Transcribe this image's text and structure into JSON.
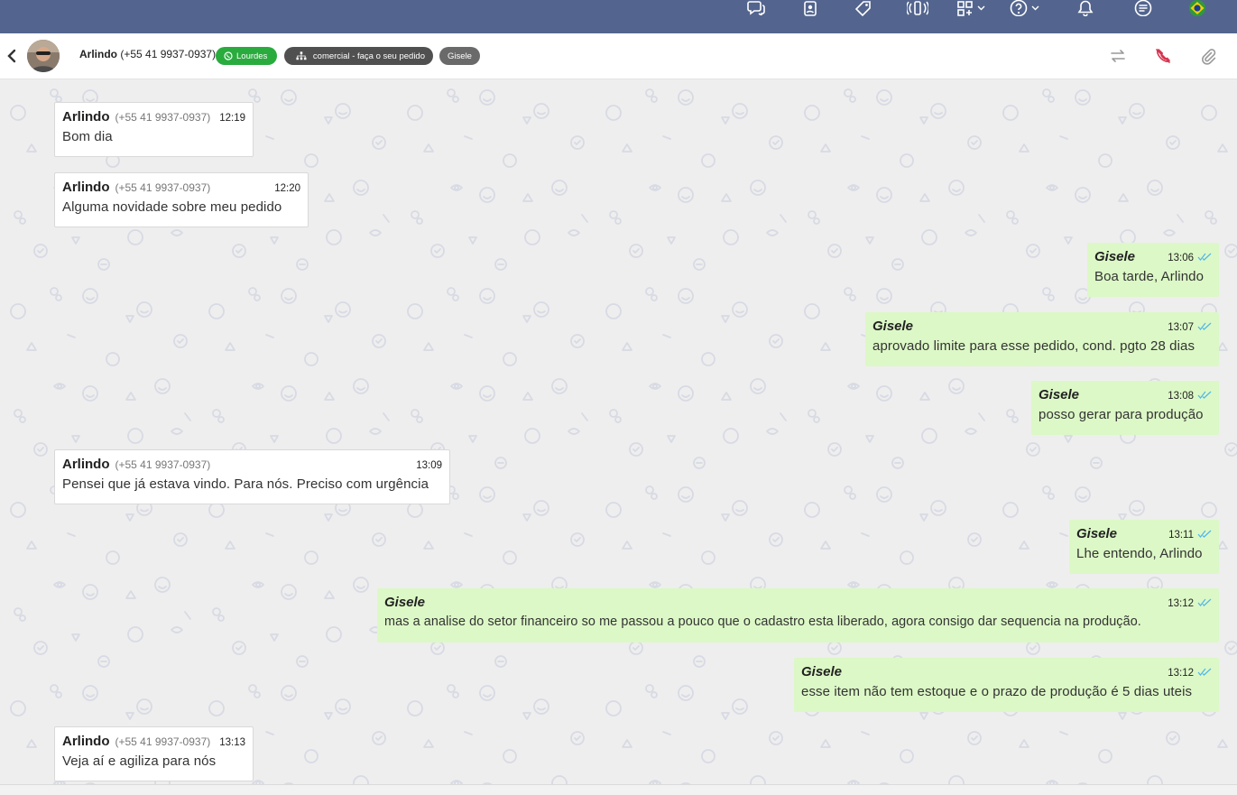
{
  "topbar": {
    "icons": [
      "chat-bubbles-icon",
      "contacts-icon",
      "tag-icon",
      "signal-icon",
      "apps-icon",
      "help-icon",
      "bell-icon",
      "list-icon",
      "brazil-flag-icon"
    ]
  },
  "header": {
    "contact_name": "Arlindo",
    "contact_phone": "(+55 41 9937-0937)",
    "channel_label": "Lourdes",
    "queue_label": "comercial - faça o seu pedido",
    "agent_label": "Gisele",
    "icons": [
      "back-chevron-icon",
      "transfer-icon",
      "end-call-icon",
      "paperclip-icon"
    ]
  },
  "colors": {
    "topbar": "#53658e",
    "channel_pill": "#2aab3e",
    "outgoing_bubble": "#dcf8c6",
    "incoming_bubble": "#ffffff",
    "read_ticks": "#4fb6ec",
    "end_call": "#d6334d"
  },
  "messages": [
    {
      "direction": "in",
      "sender": "Arlindo",
      "phone": "(+55 41 9937-0937)",
      "time": "12:19",
      "text": "Bom dia"
    },
    {
      "direction": "in",
      "sender": "Arlindo",
      "phone": "(+55 41 9937-0937)",
      "time": "12:20",
      "text": "Alguma novidade sobre meu pedido"
    },
    {
      "direction": "out",
      "sender": "Gisele",
      "time": "13:06",
      "text": "Boa tarde, Arlindo"
    },
    {
      "direction": "out",
      "sender": "Gisele",
      "time": "13:07",
      "text": "aprovado limite para esse pedido, cond. pgto 28 dias"
    },
    {
      "direction": "out",
      "sender": "Gisele",
      "time": "13:08",
      "text": "posso gerar para produção"
    },
    {
      "direction": "in",
      "sender": "Arlindo",
      "phone": "(+55 41 9937-0937)",
      "time": "13:09",
      "text": "Pensei que já estava vindo. Para nós. Preciso com urgência"
    },
    {
      "direction": "out",
      "sender": "Gisele",
      "time": "13:11",
      "text": "Lhe entendo, Arlindo"
    },
    {
      "direction": "out",
      "sender": "Gisele",
      "time": "13:12",
      "text": "mas a analise do setor financeiro so me passou a pouco que o cadastro esta liberado, agora consigo dar sequencia na produção."
    },
    {
      "direction": "out",
      "sender": "Gisele",
      "time": "13:12",
      "text": "esse item não tem estoque e o prazo de produção é 5 dias uteis"
    },
    {
      "direction": "in",
      "sender": "Arlindo",
      "phone": "(+55 41 9937-0937)",
      "time": "13:13",
      "text": "Veja aí e agiliza para nós"
    }
  ]
}
